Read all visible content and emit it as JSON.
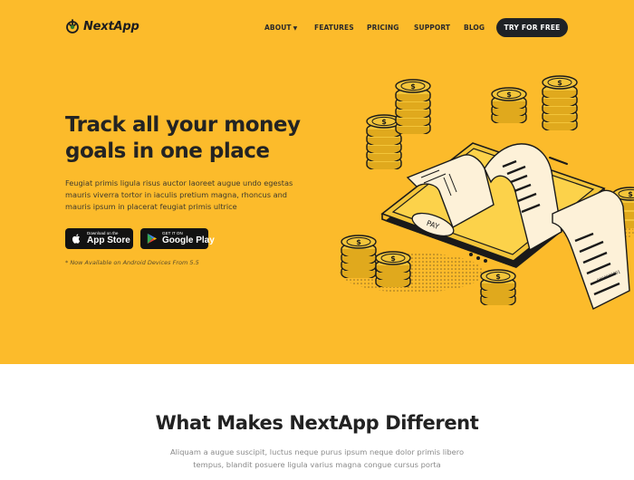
{
  "brand": {
    "name": "NextApp"
  },
  "nav": {
    "items": [
      {
        "label": "ABOUT",
        "dropdown": true
      },
      {
        "label": "FEATURES"
      },
      {
        "label": "PRICING"
      },
      {
        "label": "SUPPORT"
      },
      {
        "label": "BLOG"
      }
    ],
    "cta_label": "TRY FOR FREE"
  },
  "hero": {
    "headline": "Track all your money goals in one place",
    "subcopy": "Feugiat primis ligula risus auctor laoreet augue undo egestas mauris viverra tortor in iaculis pretium magna, rhoncus and mauris ipsum in placerat feugiat primis ultrice",
    "app_store": {
      "small": "Download on the",
      "big": "App Store"
    },
    "google_play": {
      "small": "GET IT ON",
      "big": "Google Play"
    },
    "note": "* Now Available on Android Devices From 5.5",
    "illustration": {
      "pay_label": "PAY",
      "receipt_number": "0000000001"
    }
  },
  "features": {
    "title": "What Makes NextApp Different",
    "subtitle": "Aliquam a augue suscipit, luctus neque purus ipsum neque dolor primis libero tempus, blandit posuere ligula varius magna congue cursus porta"
  },
  "colors": {
    "hero_bg": "#fcbb2b",
    "dark": "#1f2226",
    "coin": "#f3c53a",
    "paper": "#fdf1d8"
  }
}
